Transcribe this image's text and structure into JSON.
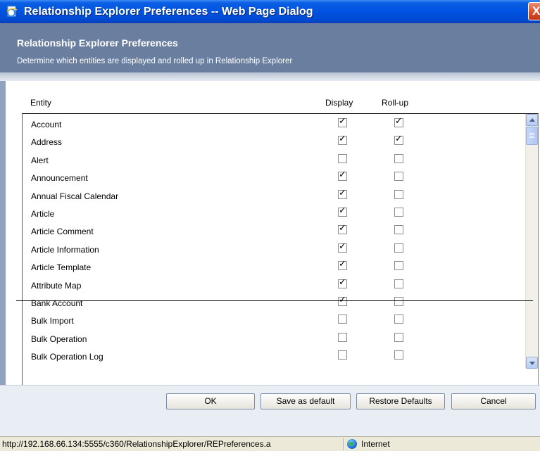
{
  "window": {
    "title": "Relationship Explorer Preferences -- Web Page Dialog",
    "close_glyph": "X"
  },
  "header": {
    "title": "Relationship Explorer Preferences",
    "subtitle": "Determine which entities are displayed and rolled up in Relationship Explorer"
  },
  "columns": {
    "entity": "Entity",
    "display": "Display",
    "rollup": "Roll-up"
  },
  "rows": [
    {
      "name": "Account",
      "display": true,
      "rollup": true
    },
    {
      "name": "Address",
      "display": true,
      "rollup": true
    },
    {
      "name": "Alert",
      "display": false,
      "rollup": false
    },
    {
      "name": "Announcement",
      "display": true,
      "rollup": false
    },
    {
      "name": "Annual Fiscal Calendar",
      "display": true,
      "rollup": false
    },
    {
      "name": "Article",
      "display": true,
      "rollup": false
    },
    {
      "name": "Article Comment",
      "display": true,
      "rollup": false
    },
    {
      "name": "Article Information",
      "display": true,
      "rollup": false
    },
    {
      "name": "Article Template",
      "display": true,
      "rollup": false
    },
    {
      "name": "Attribute Map",
      "display": true,
      "rollup": false
    },
    {
      "name": "Bank Account",
      "display": true,
      "rollup": false
    },
    {
      "name": "Bulk Import",
      "display": false,
      "rollup": false
    },
    {
      "name": "Bulk Operation",
      "display": false,
      "rollup": false
    },
    {
      "name": "Bulk Operation Log",
      "display": false,
      "rollup": false
    }
  ],
  "buttons": {
    "ok": "OK",
    "save_default": "Save as default",
    "restore_defaults": "Restore Defaults",
    "cancel": "Cancel"
  },
  "statusbar": {
    "url": "http://192.168.66.134:5555/c360/RelationshipExplorer/REPreferences.a",
    "zone": "Internet"
  }
}
